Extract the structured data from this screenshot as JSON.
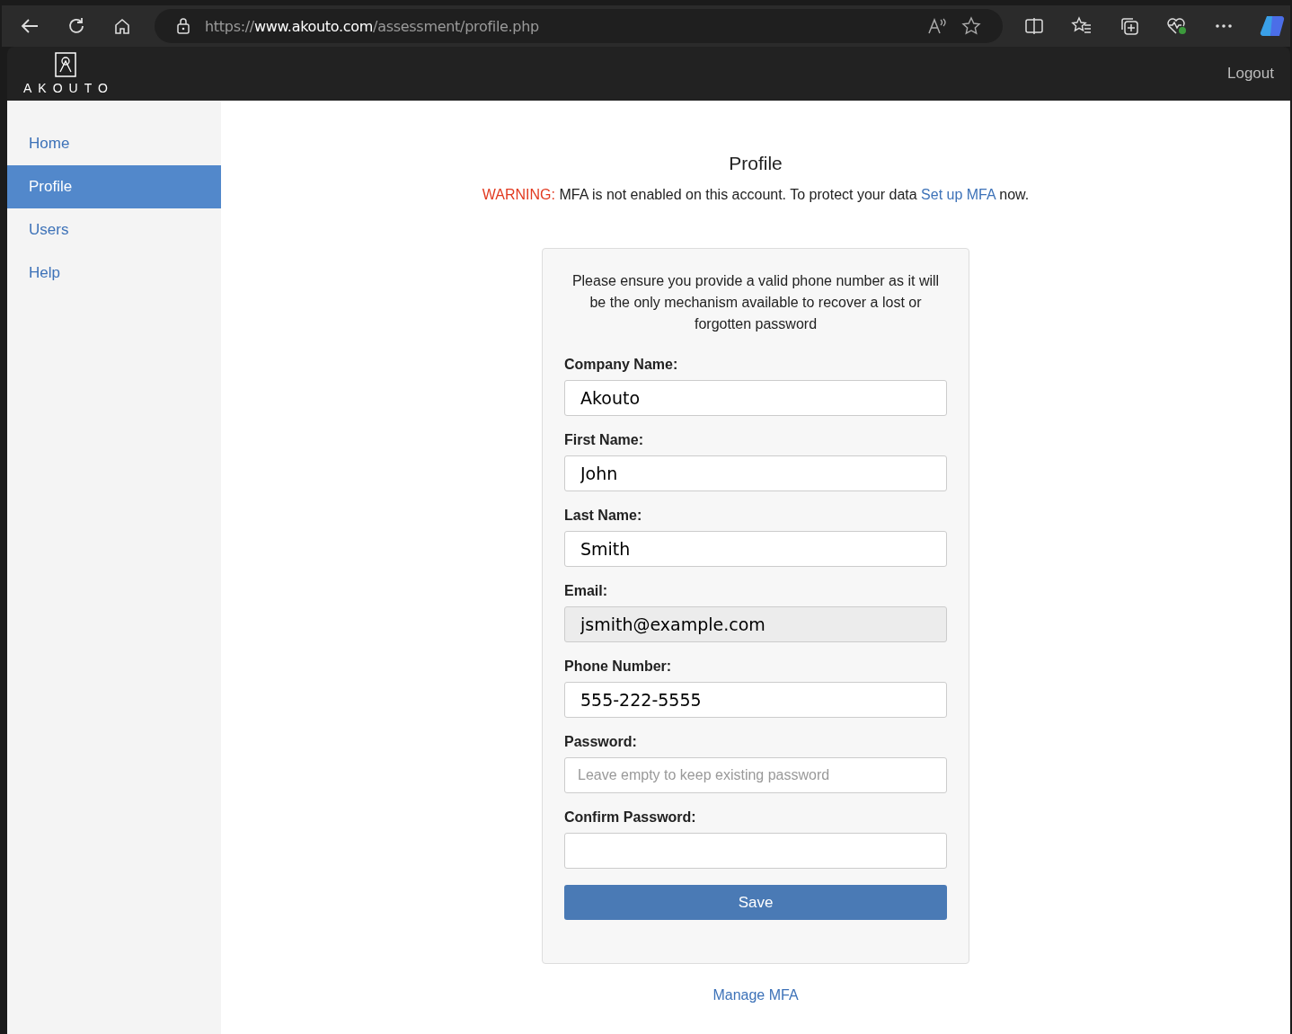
{
  "browser": {
    "url": {
      "scheme": "https://",
      "host": "www.akouto.com",
      "path": "/assessment/profile.php"
    }
  },
  "header": {
    "logo_text": "AKOUTO",
    "logout": "Logout"
  },
  "sidebar": {
    "items": [
      {
        "label": "Home",
        "selected": false
      },
      {
        "label": "Profile",
        "selected": true
      },
      {
        "label": "Users",
        "selected": false
      },
      {
        "label": "Help",
        "selected": false
      }
    ]
  },
  "page": {
    "title": "Profile",
    "warning": {
      "label": "WARNING:",
      "text": "MFA is not enabled on this account. To protect your data",
      "link": "Set up MFA",
      "suffix": "now."
    }
  },
  "form": {
    "note": "Please ensure you provide a valid phone number as it will be the only mechanism available to recover a lost or forgotten password",
    "fields": [
      {
        "label": "Company Name:",
        "value": "Akouto",
        "disabled": false
      },
      {
        "label": "First Name:",
        "value": "John",
        "disabled": false
      },
      {
        "label": "Last Name:",
        "value": "Smith",
        "disabled": false
      },
      {
        "label": "Email:",
        "value": "jsmith@example.com",
        "disabled": true
      },
      {
        "label": "Phone Number:",
        "value": "555-222-5555",
        "disabled": false
      },
      {
        "label": "Password:",
        "placeholder": "Leave empty to keep existing password",
        "disabled": false
      },
      {
        "label": "Confirm Password:",
        "disabled": false
      }
    ],
    "save": "Save"
  },
  "manage_mfa": "Manage MFA"
}
